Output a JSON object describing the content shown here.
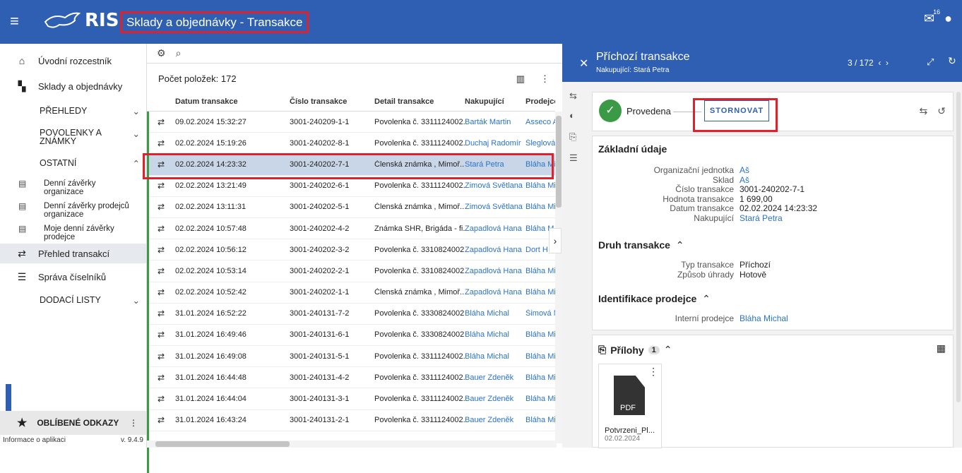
{
  "app": {
    "logo_text": "RIS",
    "page_title": "Sklady a objednávky - Transakce",
    "mail_badge": "16"
  },
  "sidebar": {
    "home": "Úvodní rozcestník",
    "sklady": "Sklady a objednávky",
    "prehledy": "PŘEHLEDY",
    "povolenky": "POVOLENKY A ZNÁMKY",
    "ostatni": "OSTATNÍ",
    "sub1": "Denní závěrky organizace",
    "sub2": "Denní závěrky prodejců organizace",
    "sub3": "Moje denní závěrky prodejce",
    "prehled": "Přehled transakcí",
    "sprava": "Správa číselníků",
    "dodaci": "DODACÍ LISTY",
    "oblibene": "OBLÍBENÉ ODKAZY",
    "info": "Informace o aplikaci",
    "version": "v. 9.4.9"
  },
  "list": {
    "count": "Počet položek: 172",
    "headers": [
      "Datum transakce",
      "Číslo transakce",
      "Detail transakce",
      "Nakupující",
      "Prodejce"
    ],
    "rows": [
      [
        "09.02.2024 15:32:27",
        "3001-240209-1-1",
        "Povolenka č. 3311124002...",
        "Barták Martin",
        "Asseco A"
      ],
      [
        "02.02.2024 15:19:26",
        "3001-240202-8-1",
        "Povolenka č. 3311124002...",
        "Duchaj Radomír",
        "Šleglová J"
      ],
      [
        "02.02.2024 14:23:32",
        "3001-240202-7-1",
        "Členská známka , Mimoř...",
        "Stará Petra",
        "Bláha Mic"
      ],
      [
        "02.02.2024 13:21:49",
        "3001-240202-6-1",
        "Povolenka č. 3311124002...",
        "Zimová Světlana",
        "Bláha Mic"
      ],
      [
        "02.02.2024 13:11:31",
        "3001-240202-5-1",
        "Členská známka , Mimoř...",
        "Zimová Světlana",
        "Bláha Mic"
      ],
      [
        "02.02.2024 10:57:48",
        "3001-240202-4-2",
        "Známka SHR, Brigáda - fi...",
        "Zapadlová Hana",
        "Bláha M"
      ],
      [
        "02.02.2024 10:56:12",
        "3001-240202-3-2",
        "Povolenka č. 3310824002...",
        "Zapadlová Hana",
        "Dort H"
      ],
      [
        "02.02.2024 10:53:14",
        "3001-240202-2-1",
        "Povolenka č. 3310824002...",
        "Zapadlová Hana",
        "Bláha Mic"
      ],
      [
        "02.02.2024 10:52:42",
        "3001-240202-1-1",
        "Členská známka , Mimoř...",
        "Zapadlová Hana",
        "Bláha Mic"
      ],
      [
        "31.01.2024 16:52:22",
        "3001-240131-7-2",
        "Povolenka č. 3330824002...",
        "Bláha Michal",
        "Šimová M"
      ],
      [
        "31.01.2024 16:49:46",
        "3001-240131-6-1",
        "Povolenka č. 3330824002...",
        "Bláha Michal",
        "Bláha Mic"
      ],
      [
        "31.01.2024 16:49:08",
        "3001-240131-5-1",
        "Povolenka č. 3311124002...",
        "Bláha Michal",
        "Bláha Mic"
      ],
      [
        "31.01.2024 16:44:48",
        "3001-240131-4-2",
        "Povolenka č. 3311124002...",
        "Bauer Zdeněk",
        "Bláha Mic"
      ],
      [
        "31.01.2024 16:44:04",
        "3001-240131-3-1",
        "Povolenka č. 3311124002...",
        "Bauer Zdeněk",
        "Bláha Mic"
      ],
      [
        "31.01.2024 16:43:24",
        "3001-240131-2-1",
        "Povolenka č. 3311124002...",
        "Bauer Zdeněk",
        "Bláha Mic"
      ]
    ]
  },
  "detail": {
    "title": "Příchozí transakce",
    "subtitle": "Nakupující: Stará Petra",
    "pager": "3 / 172",
    "status": "Provedena",
    "storno": "STORNOVAT",
    "basic_title": "Základní údaje",
    "basic": [
      {
        "k": "Organizační jednotka",
        "v": "Aš",
        "link": true
      },
      {
        "k": "Sklad",
        "v": "Aš",
        "link": true
      },
      {
        "k": "Číslo transakce",
        "v": "3001-240202-7-1",
        "link": false
      },
      {
        "k": "Hodnota transakce",
        "v": "1 699,00",
        "link": false
      },
      {
        "k": "Datum transakce",
        "v": "02.02.2024 14:23:32",
        "link": false
      },
      {
        "k": "Nakupující",
        "v": "Stará Petra",
        "link": true
      }
    ],
    "druh_title": "Druh transakce",
    "druh": [
      {
        "k": "Typ transakce",
        "v": "Příchozí"
      },
      {
        "k": "Způsob úhrady",
        "v": "Hotově"
      }
    ],
    "ident_title": "Identifikace prodejce",
    "ident": {
      "k": "Interní prodejce",
      "v": "Bláha Michal"
    },
    "attach_title": "Přílohy",
    "attach_count": "1",
    "pdf_label": "PDF",
    "file_name": "Potvrzeni_Pl...",
    "file_date": "02.02.2024"
  }
}
